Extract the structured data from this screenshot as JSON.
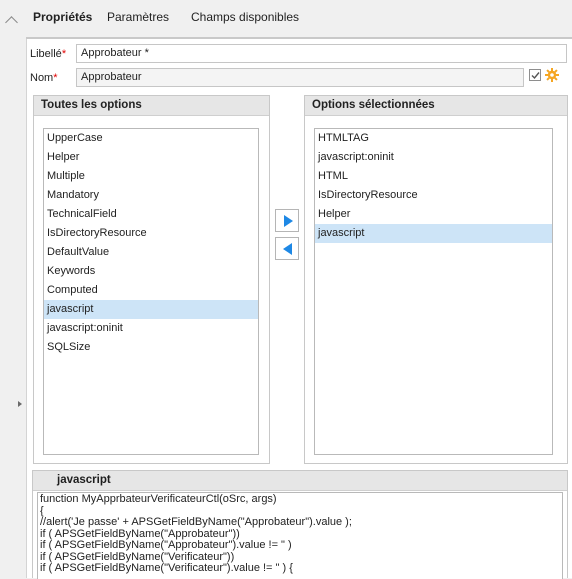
{
  "tabs": [
    "Propriétés",
    "Paramètres",
    "Champs disponibles"
  ],
  "form": {
    "libelle_label": "Libellé",
    "libelle_value": "Approbateur *",
    "nom_label": "Nom",
    "nom_value": "Approbateur",
    "required_mark": "*"
  },
  "all_options": {
    "title": "Toutes les options",
    "items": [
      "UpperCase",
      "Helper",
      "Multiple",
      "Mandatory",
      "TechnicalField",
      "IsDirectoryResource",
      "DefaultValue",
      "Keywords",
      "Computed",
      "javascript",
      "javascript:oninit",
      "SQLSize"
    ],
    "selected_index": 9
  },
  "selected_options": {
    "title": "Options sélectionnées",
    "items": [
      "HTMLTAG",
      "javascript:oninit",
      "HTML",
      "IsDirectoryResource",
      "Helper",
      "javascript"
    ],
    "selected_index": 5
  },
  "icons": {
    "move_right": "arrow-right-icon",
    "move_left": "arrow-left-icon",
    "checkbox": "checkbox-checked-icon",
    "gear": "gear-icon",
    "collapse": "chevron-up-icon",
    "expand": "chevron-right-icon"
  },
  "colors": {
    "arrow_blue": "#1e88e5",
    "selection": "#cde4f7",
    "required": "#e00000",
    "gear": "#f5a623"
  },
  "code_editor": {
    "title": "javascript",
    "lines": [
      "function MyApprbateurVerificateurCtl(oSrc, args)",
      "{",
      "//alert('Je passe' + APSGetFieldByName(\"Approbateur\").value );",
      "if ( APSGetFieldByName(\"Approbateur\"))",
      "if ( APSGetFieldByName(\"Approbateur\").value != \" )",
      "if ( APSGetFieldByName(\"Verificateur\"))",
      "if ( APSGetFieldByName(\"Verificateur\").value != \" ) {"
    ]
  }
}
